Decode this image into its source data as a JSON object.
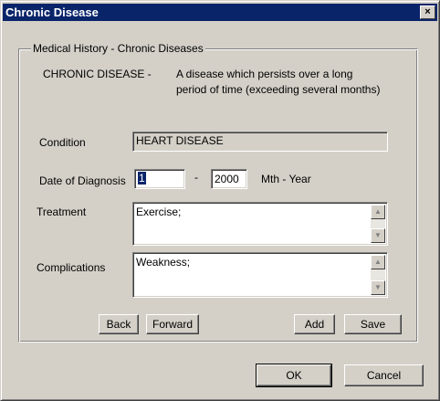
{
  "window": {
    "title": "Chronic Disease",
    "close_glyph": "×"
  },
  "group": {
    "legend": "Medical History - Chronic Diseases",
    "definition_term": "CHRONIC DISEASE -",
    "definition_line1": "A disease which persists over a long",
    "definition_line2": "period of time (exceeding several months)"
  },
  "form": {
    "condition_label": "Condition",
    "condition_value": "HEART DISEASE",
    "date_label": "Date of Diagnosis",
    "month_value": "1",
    "date_separator": "-",
    "year_value": "2000",
    "date_format_label": "Mth  - Year",
    "treatment_label": "Treatment",
    "treatment_value": "Exercise;",
    "complications_label": "Complications",
    "complications_value": "Weakness;"
  },
  "buttons": {
    "back": "Back",
    "forward": "Forward",
    "add": "Add",
    "save": "Save",
    "ok": "OK",
    "cancel": "Cancel"
  },
  "icons": {
    "close": "close-icon",
    "scroll_up": "arrow-up-icon",
    "scroll_down": "arrow-down-icon"
  },
  "colors": {
    "titlebar": "#0a246a",
    "face": "#d4d0c8"
  }
}
